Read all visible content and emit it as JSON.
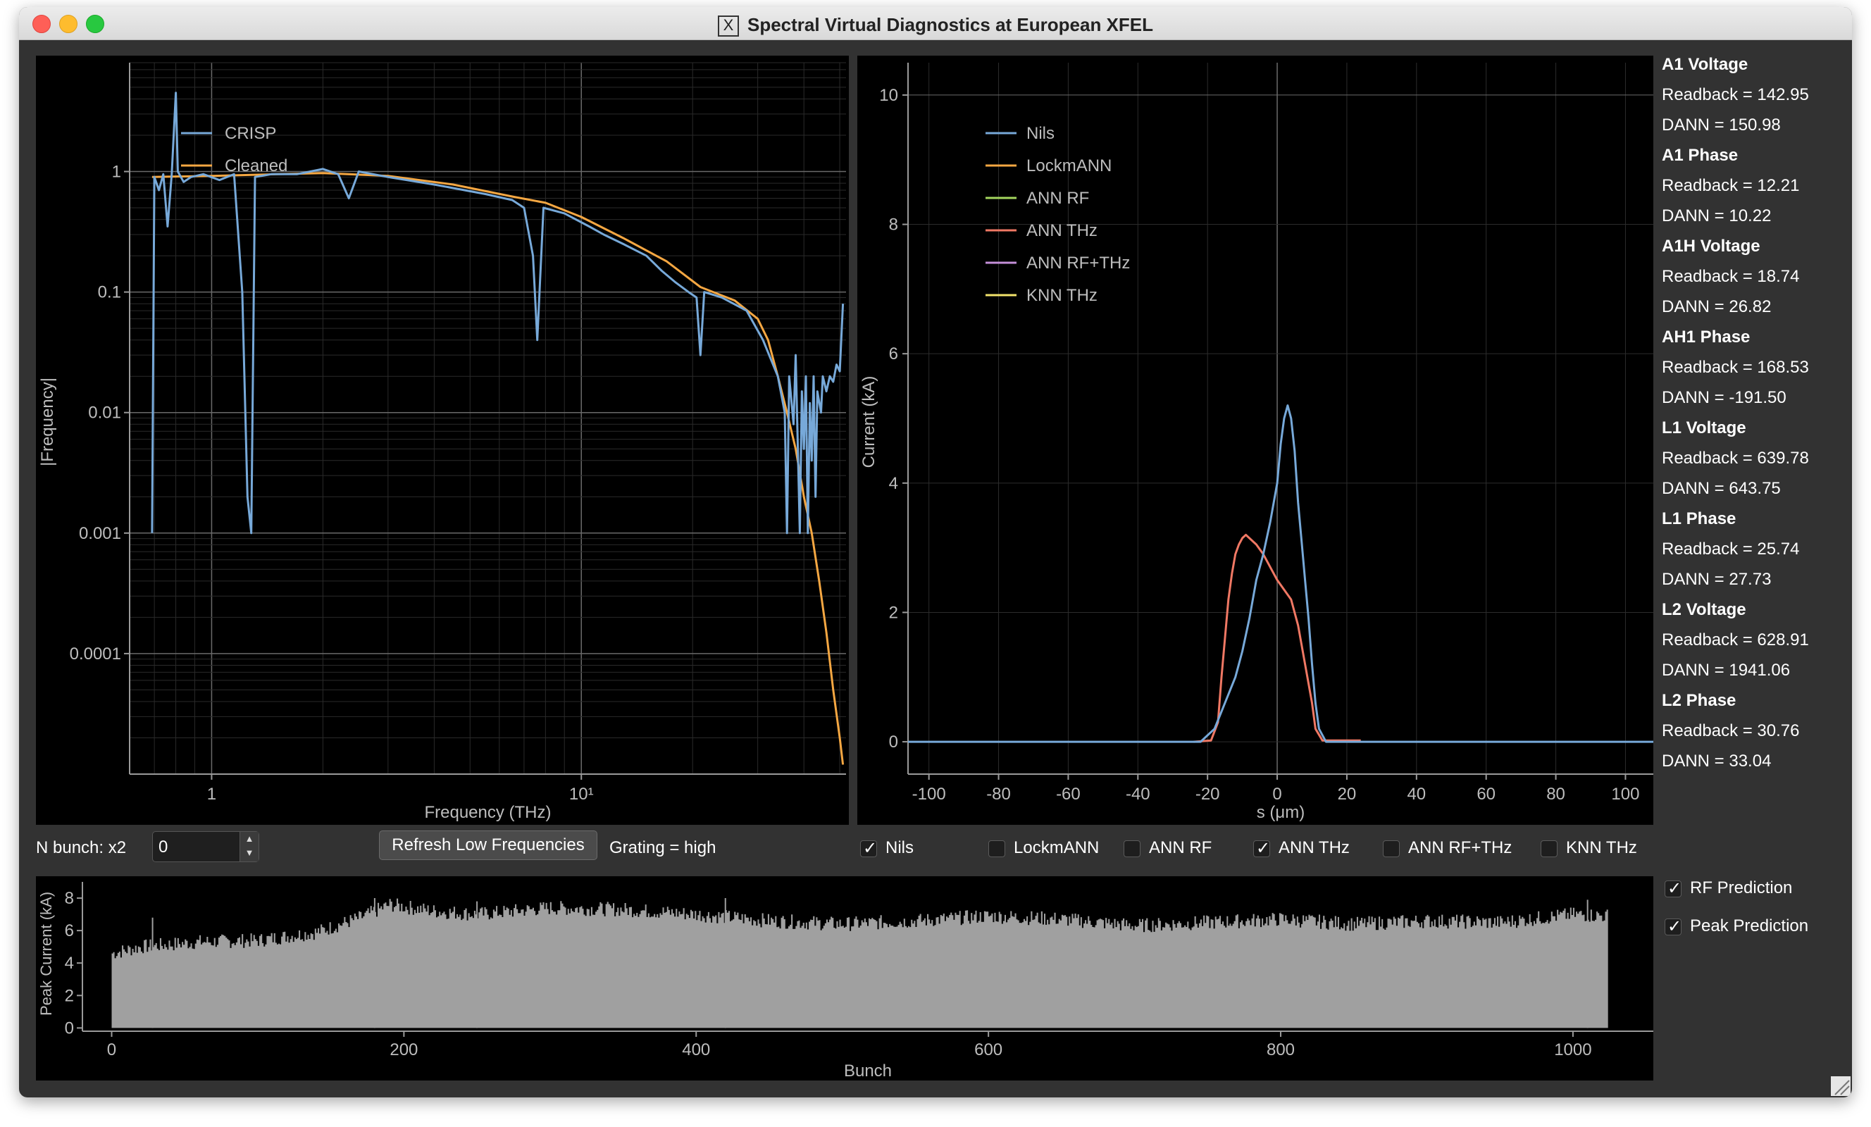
{
  "window": {
    "title": "Spectral Virtual Diagnostics at European XFEL"
  },
  "spectrum_plot": {
    "chart_data": {
      "type": "line",
      "xlabel": "Frequency (THz)",
      "ylabel": "|Frequency|",
      "xscale": "log",
      "yscale": "log",
      "xlim": [
        0.6,
        52
      ],
      "ylim": [
        1e-05,
        8
      ],
      "x_ticks": [
        "1",
        "10¹"
      ],
      "y_ticks": [
        "1",
        "0.1",
        "0.01",
        "0.001",
        "0.0001"
      ],
      "grid": true,
      "legend_position": "top-left",
      "series": [
        {
          "name": "CRISP",
          "color": "#77a9d9",
          "points": [
            [
              0.69,
              0.001
            ],
            [
              0.7,
              0.9
            ],
            [
              0.72,
              0.7
            ],
            [
              0.74,
              0.95
            ],
            [
              0.76,
              0.35
            ],
            [
              0.78,
              0.95
            ],
            [
              0.8,
              4.5
            ],
            [
              0.81,
              1.0
            ],
            [
              0.84,
              0.82
            ],
            [
              0.88,
              0.9
            ],
            [
              0.95,
              0.95
            ],
            [
              1.05,
              0.85
            ],
            [
              1.15,
              0.95
            ],
            [
              1.21,
              0.1
            ],
            [
              1.25,
              0.002
            ],
            [
              1.28,
              0.001
            ],
            [
              1.31,
              0.9
            ],
            [
              1.45,
              0.95
            ],
            [
              1.7,
              0.95
            ],
            [
              2.0,
              1.05
            ],
            [
              2.2,
              0.95
            ],
            [
              2.35,
              0.6
            ],
            [
              2.5,
              1.0
            ],
            [
              3.0,
              0.9
            ],
            [
              4.0,
              0.78
            ],
            [
              5.5,
              0.65
            ],
            [
              6.5,
              0.58
            ],
            [
              7.0,
              0.5
            ],
            [
              7.4,
              0.2
            ],
            [
              7.6,
              0.04
            ],
            [
              7.9,
              0.5
            ],
            [
              9.0,
              0.45
            ],
            [
              10.5,
              0.35
            ],
            [
              11.5,
              0.3
            ],
            [
              13.0,
              0.25
            ],
            [
              15.0,
              0.2
            ],
            [
              16.5,
              0.15
            ],
            [
              18.0,
              0.12
            ],
            [
              19.5,
              0.1
            ],
            [
              20.5,
              0.09
            ],
            [
              21.0,
              0.03
            ],
            [
              21.5,
              0.1
            ],
            [
              24.0,
              0.09
            ],
            [
              28.0,
              0.07
            ],
            [
              31.0,
              0.04
            ],
            [
              34.0,
              0.02
            ],
            [
              35.5,
              0.01
            ],
            [
              36.0,
              0.001
            ],
            [
              36.5,
              0.02
            ],
            [
              37.5,
              0.008
            ],
            [
              38.0,
              0.03
            ],
            [
              39.0,
              0.001
            ],
            [
              39.5,
              0.015
            ],
            [
              40.0,
              0.005
            ],
            [
              40.5,
              0.02
            ],
            [
              41.0,
              0.001
            ],
            [
              41.5,
              0.012
            ],
            [
              42.0,
              0.004
            ],
            [
              42.5,
              0.02
            ],
            [
              43.0,
              0.002
            ],
            [
              43.5,
              0.015
            ],
            [
              44.5,
              0.01
            ],
            [
              45.0,
              0.02
            ],
            [
              46.0,
              0.015
            ],
            [
              47.0,
              0.02
            ],
            [
              48.0,
              0.018
            ],
            [
              49.0,
              0.025
            ],
            [
              50.0,
              0.022
            ],
            [
              51.0,
              0.08
            ]
          ]
        },
        {
          "name": "Cleaned",
          "color": "#f5a742",
          "points": [
            [
              0.69,
              0.9
            ],
            [
              1.0,
              0.92
            ],
            [
              1.5,
              0.95
            ],
            [
              2.0,
              0.97
            ],
            [
              3.0,
              0.92
            ],
            [
              4.5,
              0.78
            ],
            [
              6.5,
              0.62
            ],
            [
              8.0,
              0.55
            ],
            [
              10.0,
              0.42
            ],
            [
              13.0,
              0.28
            ],
            [
              17.0,
              0.18
            ],
            [
              21.0,
              0.11
            ],
            [
              26.0,
              0.085
            ],
            [
              30.0,
              0.06
            ],
            [
              32.0,
              0.04
            ],
            [
              34.0,
              0.02
            ],
            [
              36.0,
              0.01
            ],
            [
              38.0,
              0.005
            ],
            [
              40.0,
              0.002
            ],
            [
              42.0,
              0.001
            ],
            [
              44.0,
              0.0004
            ],
            [
              46.0,
              0.00015
            ],
            [
              48.0,
              5e-05
            ],
            [
              50.0,
              2e-05
            ],
            [
              51.0,
              1.2e-05
            ]
          ]
        }
      ]
    }
  },
  "current_plot": {
    "chart_data": {
      "type": "line",
      "xlabel": "s (μm)",
      "ylabel": "Current (kA)",
      "xlim": [
        -106,
        108
      ],
      "ylim": [
        -0.5,
        10.5
      ],
      "x_ticks": [
        -100,
        -80,
        -60,
        -40,
        -20,
        0,
        20,
        40,
        60,
        80,
        100
      ],
      "y_ticks": [
        0,
        2,
        4,
        6,
        8,
        10
      ],
      "grid": true,
      "legend_position": "top-left",
      "series": [
        {
          "name": "Nils",
          "color": "#77a9d9",
          "points": [
            [
              -106,
              0
            ],
            [
              -22,
              0
            ],
            [
              -18,
              0.2
            ],
            [
              -15,
              0.6
            ],
            [
              -12,
              1.0
            ],
            [
              -10,
              1.4
            ],
            [
              -8,
              1.9
            ],
            [
              -6,
              2.5
            ],
            [
              -4,
              2.9
            ],
            [
              -2,
              3.4
            ],
            [
              0,
              4.0
            ],
            [
              1,
              4.6
            ],
            [
              2,
              5.0
            ],
            [
              3,
              5.2
            ],
            [
              4,
              5.0
            ],
            [
              5,
              4.5
            ],
            [
              6,
              3.7
            ],
            [
              7,
              3.1
            ],
            [
              8,
              2.5
            ],
            [
              9,
              1.9
            ],
            [
              10,
              1.2
            ],
            [
              11,
              0.6
            ],
            [
              12,
              0.2
            ],
            [
              14,
              0
            ],
            [
              108,
              0
            ]
          ]
        },
        {
          "name": "LockmANN",
          "color": "#f5a742",
          "points": []
        },
        {
          "name": "ANN RF",
          "color": "#a4d65e",
          "points": []
        },
        {
          "name": "ANN THz",
          "color": "#f07864",
          "points": [
            [
              -24,
              0
            ],
            [
              -19,
              0.02
            ],
            [
              -17,
              0.3
            ],
            [
              -16,
              1.0
            ],
            [
              -15,
              1.6
            ],
            [
              -14,
              2.2
            ],
            [
              -13,
              2.6
            ],
            [
              -12,
              2.9
            ],
            [
              -11,
              3.05
            ],
            [
              -10,
              3.15
            ],
            [
              -9,
              3.2
            ],
            [
              -8,
              3.15
            ],
            [
              -6,
              3.05
            ],
            [
              -4,
              2.9
            ],
            [
              -2,
              2.7
            ],
            [
              0,
              2.5
            ],
            [
              2,
              2.35
            ],
            [
              4,
              2.2
            ],
            [
              6,
              1.8
            ],
            [
              8,
              1.2
            ],
            [
              10,
              0.6
            ],
            [
              11,
              0.2
            ],
            [
              13,
              0.02
            ],
            [
              24,
              0.02
            ]
          ]
        },
        {
          "name": "ANN RF+THz",
          "color": "#c58fd9",
          "points": []
        },
        {
          "name": "KNN THz",
          "color": "#f2e36b",
          "points": []
        }
      ]
    }
  },
  "readouts": [
    {
      "title": "A1 Voltage",
      "readback": "Readback = 142.95",
      "dann": "DANN = 150.98"
    },
    {
      "title": "A1 Phase",
      "readback": "Readback = 12.21",
      "dann": "DANN = 10.22"
    },
    {
      "title": "A1H Voltage",
      "readback": "Readback = 18.74",
      "dann": "DANN = 26.82"
    },
    {
      "title": "AH1 Phase",
      "readback": "Readback = 168.53",
      "dann": "DANN = -191.50"
    },
    {
      "title": "L1 Voltage",
      "readback": "Readback = 639.78",
      "dann": "DANN = 643.75"
    },
    {
      "title": "L1 Phase",
      "readback": "Readback = 25.74",
      "dann": "DANN = 27.73"
    },
    {
      "title": "L2 Voltage",
      "readback": "Readback = 628.91",
      "dann": "DANN = 1941.06"
    },
    {
      "title": "L2 Phase",
      "readback": "Readback = 30.76",
      "dann": "DANN = 33.04"
    }
  ],
  "controls": {
    "n_bunch_label": "N bunch: x2",
    "n_bunch_value": "0",
    "refresh_button": "Refresh Low Frequencies",
    "grating_label": "Grating = high",
    "toggles": [
      {
        "label": "Nils",
        "checked": true
      },
      {
        "label": "LockmANN",
        "checked": false
      },
      {
        "label": "ANN RF",
        "checked": false
      },
      {
        "label": "ANN THz",
        "checked": true
      },
      {
        "label": "ANN RF+THz",
        "checked": false
      },
      {
        "label": "KNN THz",
        "checked": false
      }
    ],
    "rf_prediction": {
      "label": "RF Prediction",
      "checked": true
    },
    "peak_prediction": {
      "label": "Peak Prediction",
      "checked": true
    }
  },
  "bunch_plot": {
    "chart_data": {
      "type": "bar",
      "xlabel": "Bunch",
      "ylabel": "Peak Current (kA)",
      "xlim": [
        -20,
        1055
      ],
      "ylim": [
        -0.2,
        9.0
      ],
      "x_ticks": [
        0,
        200,
        400,
        600,
        800,
        1000
      ],
      "y_ticks": [
        0,
        2,
        4,
        6,
        8
      ],
      "bar_count": 1024,
      "bar_color": "#a0a0a0",
      "envelope": [
        [
          0,
          4.6
        ],
        [
          20,
          5.0
        ],
        [
          60,
          5.3
        ],
        [
          100,
          5.4
        ],
        [
          140,
          5.9
        ],
        [
          170,
          6.8
        ],
        [
          190,
          7.6
        ],
        [
          220,
          7.2
        ],
        [
          250,
          7.0
        ],
        [
          300,
          7.4
        ],
        [
          350,
          7.3
        ],
        [
          400,
          7.0
        ],
        [
          450,
          6.6
        ],
        [
          500,
          6.4
        ],
        [
          550,
          6.6
        ],
        [
          600,
          6.9
        ],
        [
          650,
          6.7
        ],
        [
          700,
          6.3
        ],
        [
          750,
          6.5
        ],
        [
          800,
          6.7
        ],
        [
          850,
          6.4
        ],
        [
          900,
          6.6
        ],
        [
          950,
          6.5
        ],
        [
          1000,
          7.0
        ],
        [
          1023,
          6.9
        ]
      ],
      "notes_spikes": [
        [
          28,
          6.8
        ],
        [
          180,
          8.0
        ],
        [
          250,
          7.8
        ],
        [
          420,
          8.0
        ],
        [
          1010,
          7.9
        ]
      ]
    }
  }
}
